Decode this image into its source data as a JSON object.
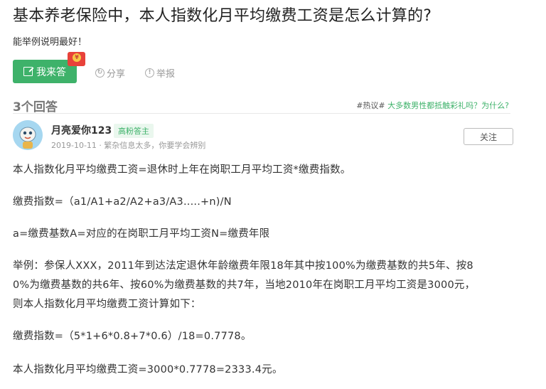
{
  "question": {
    "title": "基本养老保险中，本人指数化月平均缴费工资是怎么计算的?",
    "description": "能举例说明最好！"
  },
  "actions": {
    "answer_label": "我来答",
    "share_label": "分享",
    "report_label": "举报"
  },
  "answers_header": {
    "count_label": "3个回答",
    "hot_prefix": "#热议#",
    "hot_link": "大多数男性都抵触彩礼吗？为什么?"
  },
  "answer": {
    "username": "月亮爱你123",
    "badge": "高粉答主",
    "meta": "2019-10-11 · 繁杂信息太多，你要学会辨别",
    "follow_label": "关注",
    "lines": [
      "本人指数化月平均缴费工资=退休时上年在岗职工月平均工资*缴费指数。",
      "缴费指数=（a1/A1+a2/A2+a3/A3.....+n)/N",
      "a=缴费基数A=对应的在岗职工月平均工资N=缴费年限",
      "举例：参保人XXX，2011年到达法定退休年龄缴费年限18年其中按100%为缴费基数的共5年、按8",
      "0%为缴费基数的共6年、按60%为缴费基数的共7年，当地2010年在岗职工月平均工资是3000元，",
      "则本人指数化月平均缴费工资计算如下：",
      "缴费指数=（5*1+6*0.8+7*0.6）/18=0.7778。",
      "本人指数化月平均缴费工资=3000*0.7778=2333.4元。"
    ]
  },
  "colors": {
    "accent": "#3eb26a",
    "redpacket": "#e8423a"
  }
}
